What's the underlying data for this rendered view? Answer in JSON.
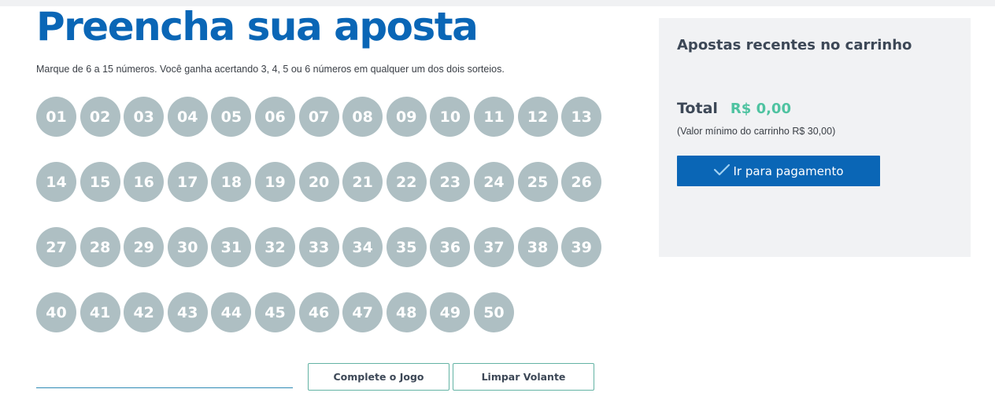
{
  "bet": {
    "title": "Preencha sua aposta",
    "instructions": "Marque de 6 a 15 números. Você ganha acertando 3, 4, 5 ou 6 números em qualquer um dos dois sorteios.",
    "numbers": [
      "01",
      "02",
      "03",
      "04",
      "05",
      "06",
      "07",
      "08",
      "09",
      "10",
      "11",
      "12",
      "13",
      "14",
      "15",
      "16",
      "17",
      "18",
      "19",
      "20",
      "21",
      "22",
      "23",
      "24",
      "25",
      "26",
      "27",
      "28",
      "29",
      "30",
      "31",
      "32",
      "33",
      "34",
      "35",
      "36",
      "37",
      "38",
      "39",
      "40",
      "41",
      "42",
      "43",
      "44",
      "45",
      "46",
      "47",
      "48",
      "49",
      "50"
    ],
    "ball_color": "#aebfc3",
    "input_value": "",
    "complete_label": "Complete o Jogo",
    "clear_label": "Limpar Volante"
  },
  "cart": {
    "title": "Apostas recentes no carrinho",
    "total_label": "Total",
    "total_value": "R$ 0,00",
    "min_note": "(Valor mínimo do carrinho R$ 30,00)",
    "pay_label": "Ir para pagamento",
    "pay_icon": "check-icon"
  },
  "colors": {
    "brand_blue": "#0a66b6",
    "accent_green": "#4fc3a1",
    "outline_teal": "#63b3a4"
  }
}
